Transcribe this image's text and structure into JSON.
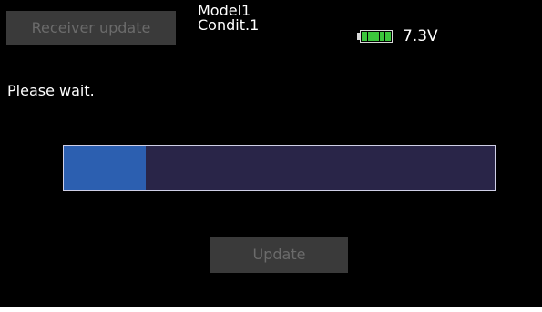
{
  "header": {
    "title_button_label": "Receiver update",
    "model_name": "Model1",
    "condition": "Condit.1",
    "battery_icon": "battery-icon",
    "battery_level": 1.0,
    "battery_color": "#3cc63c",
    "voltage": "7.3V"
  },
  "main": {
    "message": "Please wait.",
    "progress_fraction": 0.19,
    "progress_fill_color": "#2c5fb0",
    "progress_track_color": "#292548",
    "update_button_label": "Update"
  },
  "colors": {
    "background": "#000000",
    "disabled_button": "#3a3a3a",
    "disabled_text": "#6b6b6b",
    "text": "#ffffff"
  }
}
